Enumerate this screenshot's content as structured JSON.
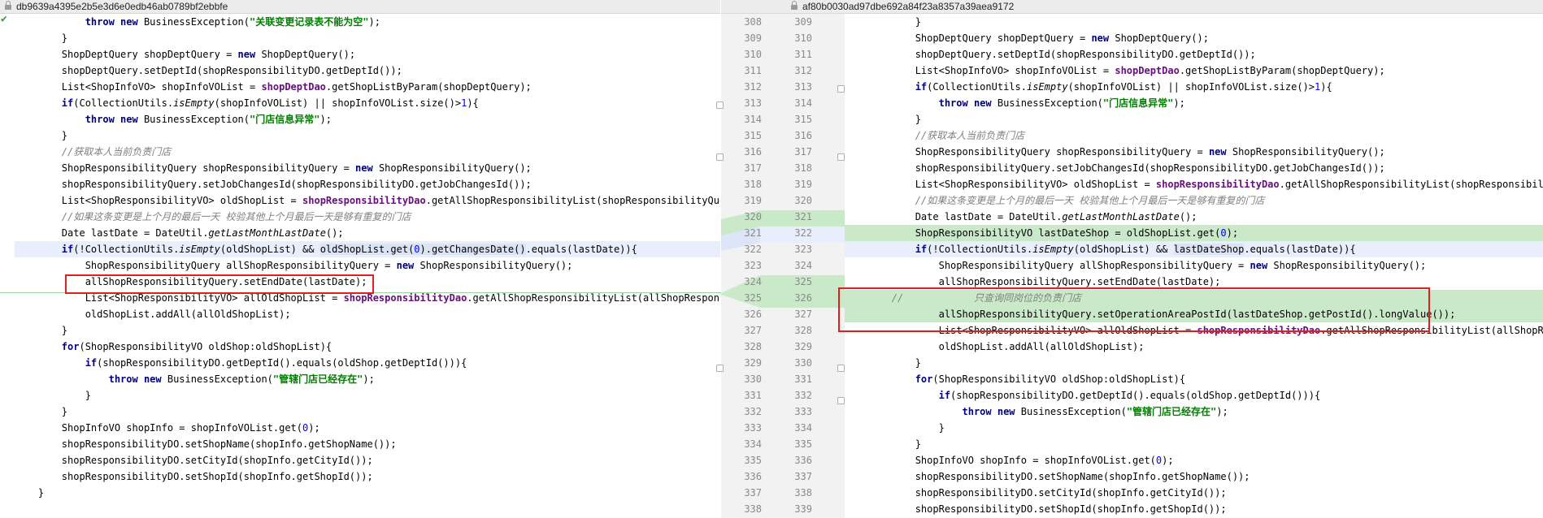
{
  "left_title": "db9639a4395e2b5e3d6e0edb46ab0789bf2ebbfe",
  "right_title": "af80b0030ad97dbe692a84f23a8357a39aea9172",
  "left_lines": [
    {
      "html": "        <span class=\"kw\">throw new</span> BusinessException(<span class=\"str\">\"关联变更记录表不能为空\"</span>);"
    },
    {
      "html": "    }"
    },
    {
      "html": "    ShopDeptQuery shopDeptQuery = <span class=\"kw\">new</span> ShopDeptQuery();"
    },
    {
      "html": "    shopDeptQuery.setDeptId(shopResponsibilityDO.getDeptId());"
    },
    {
      "html": "    List&lt;ShopInfoVO&gt; shopInfoVOList = <span class=\"fld\">shopDeptDao</span>.getShopListByParam(shopDeptQuery);"
    },
    {
      "html": "    <span class=\"kw\">if</span>(CollectionUtils.<span class=\"ital\">isEmpty</span>(shopInfoVOList) || shopInfoVOList.size()&gt;<span class=\"num\">1</span>){"
    },
    {
      "html": "        <span class=\"kw\">throw new</span> BusinessException(<span class=\"str\">\"门店信息异常\"</span>);"
    },
    {
      "html": "    }"
    },
    {
      "html": "    <span class=\"cmt\">//获取本人当前负责门店</span>"
    },
    {
      "html": "    ShopResponsibilityQuery shopResponsibilityQuery = <span class=\"kw\">new</span> ShopResponsibilityQuery();"
    },
    {
      "html": "    shopResponsibilityQuery.setJobChangesId(shopResponsibilityDO.getJobChangesId());"
    },
    {
      "html": "    List&lt;ShopResponsibilityVO&gt; oldShopList = <span class=\"fld\">shopResponsibilityDao</span>.getAllShopResponsibilityList(shopResponsibilityQuery"
    },
    {
      "html": "    <span class=\"cmt\">//如果这条变更是上个月的最后一天 校验其他上个月最后一天是够有重复的门店</span>"
    },
    {
      "html": "    Date lastDate = DateUtil.<span class=\"ital\">getLastMonthLastDate</span>();"
    },
    {
      "html": "    <span class=\"kw\">if</span>(!CollectionUtils.<span class=\"ital\">isEmpty</span>(oldShopList) &amp;&amp; <span class=\"selbg\">oldShopList.get(<span class=\"num\">0</span>).getChangesDate()</span>.equals(lastDate)){",
      "cls": "hl-mod"
    },
    {
      "html": "        ShopResponsibilityQuery allShopResponsibilityQuery = <span class=\"kw\">new</span> ShopResponsibilityQuery();"
    },
    {
      "html": "        allShopResponsibilityQuery.setEndDate(lastDate);"
    },
    {
      "html": "        List&lt;ShopResponsibilityVO&gt; allOldShopList = <span class=\"fld\">shopResponsibilityDao</span>.getAllShopResponsibilityList(allShopResponsib"
    },
    {
      "html": "        oldShopList.addAll(allOldShopList);"
    },
    {
      "html": "    }"
    },
    {
      "html": "    <span class=\"kw\">for</span>(ShopResponsibilityVO oldShop:oldShopList){"
    },
    {
      "html": "        <span class=\"kw\">if</span>(shopResponsibilityDO.getDeptId().equals(oldShop.getDeptId())){"
    },
    {
      "html": "            <span class=\"kw\">throw new</span> BusinessException(<span class=\"str\">\"管辖门店已经存在\"</span>);"
    },
    {
      "html": "        }"
    },
    {
      "html": "    }"
    },
    {
      "html": "    ShopInfoVO shopInfo = shopInfoVOList.get(<span class=\"num\">0</span>);"
    },
    {
      "html": "    shopResponsibilityDO.setShopName(shopInfo.getShopName());"
    },
    {
      "html": "    shopResponsibilityDO.setCityId(shopInfo.getCityId());"
    },
    {
      "html": "    shopResponsibilityDO.setShopId(shopInfo.getShopId());"
    },
    {
      "html": "}"
    }
  ],
  "right_lines": [
    {
      "l": "308",
      "r": "309",
      "html": "    }"
    },
    {
      "l": "309",
      "r": "310",
      "html": "    ShopDeptQuery shopDeptQuery = <span class=\"kw\">new</span> ShopDeptQuery();"
    },
    {
      "l": "310",
      "r": "311",
      "html": "    shopDeptQuery.setDeptId(shopResponsibilityDO.getDeptId());"
    },
    {
      "l": "311",
      "r": "312",
      "html": "    List&lt;ShopInfoVO&gt; shopInfoVOList = <span class=\"fld\">shopDeptDao</span>.getShopListByParam(shopDeptQuery);"
    },
    {
      "l": "312",
      "r": "313",
      "html": "    <span class=\"kw\">if</span>(CollectionUtils.<span class=\"ital\">isEmpty</span>(shopInfoVOList) || shopInfoVOList.size()&gt;<span class=\"num\">1</span>){"
    },
    {
      "l": "313",
      "r": "314",
      "html": "        <span class=\"kw\">throw new</span> BusinessException(<span class=\"str\">\"门店信息异常\"</span>);"
    },
    {
      "l": "314",
      "r": "315",
      "html": "    }"
    },
    {
      "l": "315",
      "r": "316",
      "html": "    <span class=\"cmt\">//获取本人当前负责门店</span>"
    },
    {
      "l": "316",
      "r": "317",
      "html": "    ShopResponsibilityQuery shopResponsibilityQuery = <span class=\"kw\">new</span> ShopResponsibilityQuery();"
    },
    {
      "l": "317",
      "r": "318",
      "html": "    shopResponsibilityQuery.setJobChangesId(shopResponsibilityDO.getJobChangesId());"
    },
    {
      "l": "318",
      "r": "319",
      "html": "    List&lt;ShopResponsibilityVO&gt; oldShopList = <span class=\"fld\">shopResponsibilityDao</span>.getAllShopResponsibilityList(shopResponsibilityQuery"
    },
    {
      "l": "319",
      "r": "320",
      "html": "    <span class=\"cmt\">//如果这条变更是上个月的最后一天 校验其他上个月最后一天是够有重复的门店</span>"
    },
    {
      "l": "320",
      "r": "321",
      "html": "    Date lastDate = DateUtil.<span class=\"ital\">getLastMonthLastDate</span>();"
    },
    {
      "l": "321",
      "r": "322",
      "html": "    ShopResponsibilityVO lastDateShop = oldShopList.get(<span class=\"num\">0</span>);",
      "cls": "hl-add"
    },
    {
      "l": "322",
      "r": "323",
      "html": "    <span class=\"kw\">if</span>(!CollectionUtils.<span class=\"ital\">isEmpty</span>(oldShopList) &amp;&amp; <span class=\"selbg\">lastDateShop</span>.equals(lastDate)){",
      "cls": "hl-mod"
    },
    {
      "l": "323",
      "r": "324",
      "html": "        ShopResponsibilityQuery allShopResponsibilityQuery = <span class=\"kw\">new</span> ShopResponsibilityQuery();"
    },
    {
      "l": "324",
      "r": "325",
      "html": "        allShopResponsibilityQuery.setEndDate(lastDate);"
    },
    {
      "l": "325",
      "r": "326",
      "html": "<span class=\"cmt\">//            只查询同岗位的负责门店</span>",
      "cls": "hl-add"
    },
    {
      "l": "326",
      "r": "327",
      "html": "        allShopResponsibilityQuery.setOperationAreaPostId(lastDateShop.getPostId().longValue());",
      "cls": "hl-add"
    },
    {
      "l": "327",
      "r": "328",
      "html": "        List&lt;ShopResponsibilityVO&gt; allOldShopList = <span class=\"fld\">shopResponsibilityDao</span>.getAllShopResponsibilityList(allShopResponsib"
    },
    {
      "l": "328",
      "r": "329",
      "html": "        oldShopList.addAll(allOldShopList);"
    },
    {
      "l": "329",
      "r": "330",
      "html": "    }"
    },
    {
      "l": "330",
      "r": "331",
      "html": "    <span class=\"kw\">for</span>(ShopResponsibilityVO oldShop:oldShopList){"
    },
    {
      "l": "331",
      "r": "332",
      "html": "        <span class=\"kw\">if</span>(shopResponsibilityDO.getDeptId().equals(oldShop.getDeptId())){"
    },
    {
      "l": "332",
      "r": "333",
      "html": "            <span class=\"kw\">throw new</span> BusinessException(<span class=\"str\">\"管辖门店已经存在\"</span>);"
    },
    {
      "l": "333",
      "r": "334",
      "html": "        }"
    },
    {
      "l": "334",
      "r": "335",
      "html": "    }"
    },
    {
      "l": "335",
      "r": "336",
      "html": "    ShopInfoVO shopInfo = shopInfoVOList.get(<span class=\"num\">0</span>);"
    },
    {
      "l": "336",
      "r": "337",
      "html": "    shopResponsibilityDO.setShopName(shopInfo.getShopName());"
    },
    {
      "l": "337",
      "r": "338",
      "html": "    shopResponsibilityDO.setCityId(shopInfo.getCityId());"
    },
    {
      "l": "338",
      "r": "339",
      "html": "    shopResponsibilityDO.setShopId(shopInfo.getShopId());"
    }
  ]
}
